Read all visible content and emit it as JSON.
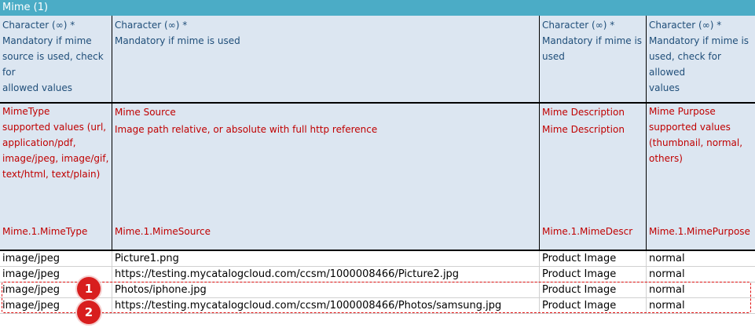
{
  "sheet_title": "Mime (1)",
  "header_rows": {
    "type_row": [
      "Character (∞) *\nMandatory if mime\nsource is used, check for\nallowed values",
      "Character (∞) *\nMandatory if mime is used",
      "Character (∞) *\nMandatory if mime is\nused",
      "Character (∞) *\nMandatory if mime is\nused, check for allowed\nvalues"
    ],
    "name_row": [
      "MimeType\nsupported values (url,\napplication/pdf,\nimage/jpeg, image/gif,\ntext/html, text/plain)",
      "Mime Source\nImage path relative, or absolute with full http reference",
      "Mime Description\nMime Description",
      "Mime Purpose\nsupported values\n(thumbnail, normal,\nothers)"
    ],
    "key_row": [
      "Mime.1.MimeType",
      "Mime.1.MimeSource",
      "Mime.1.MimeDescr",
      "Mime.1.MimePurpose"
    ]
  },
  "rows": [
    [
      "image/jpeg",
      "Picture1.png",
      "Product Image",
      "normal"
    ],
    [
      "image/jpeg",
      "https://testing.mycatalogcloud.com/ccsm/1000008466/Picture2.jpg",
      "Product Image",
      "normal"
    ],
    [
      "image/jpeg",
      "Photos/iphone.jpg",
      "Product Image",
      "normal"
    ],
    [
      "image/jpeg",
      "https://testing.mycatalogcloud.com/ccsm/1000008466/Photos/samsung.jpg",
      "Product Image",
      "normal"
    ]
  ],
  "markers": [
    "1",
    "2"
  ],
  "colors": {
    "title_bar": "#4bacc6",
    "header_band": "#dce6f1",
    "type_text": "#1f4e79",
    "name_text": "#c00000",
    "marker": "#d81e1e"
  }
}
